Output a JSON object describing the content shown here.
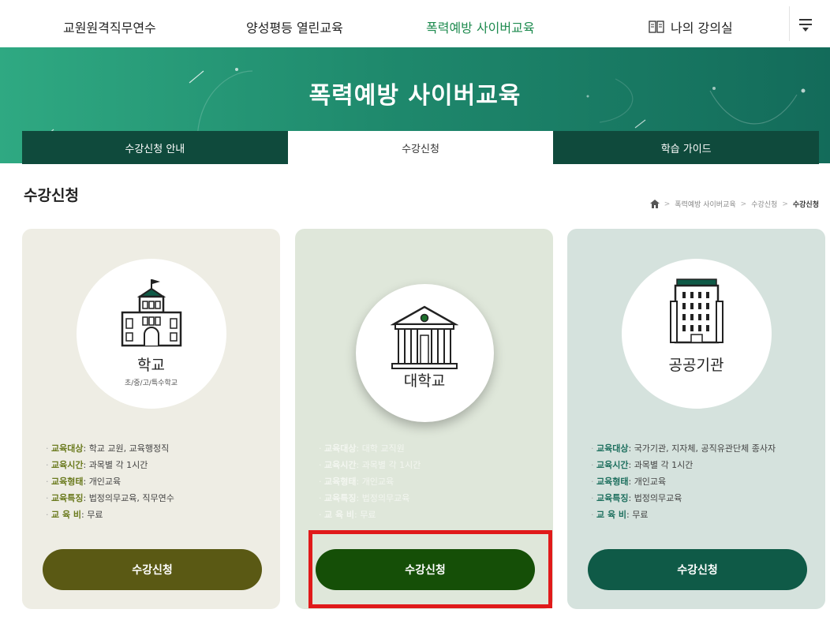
{
  "topnav": {
    "items": [
      "교원원격직무연수",
      "양성평등 열린교육",
      "폭력예방 사이버교육"
    ],
    "my_classroom": "나의 강의실",
    "menu_icon": "menu-icon"
  },
  "banner": {
    "title": "폭력예방 사이버교육"
  },
  "tabs": [
    "수강신청 안내",
    "수강신청",
    "학습 가이드"
  ],
  "page": {
    "title": "수강신청"
  },
  "breadcrumb": {
    "items": [
      "폭력예방 사이버교육",
      "수강신청"
    ],
    "current": "수강신청"
  },
  "cards": [
    {
      "name": "학교",
      "sub": "초/중/고/특수학교",
      "info": [
        {
          "label": "교육대상",
          "value": "학교 교원, 교육행정직"
        },
        {
          "label": "교육시간",
          "value": "과목별 각 1시간"
        },
        {
          "label": "교육형태",
          "value": "개인교육"
        },
        {
          "label": "교육특징",
          "value": "법정의무교육, 직무연수"
        },
        {
          "label": "교 육 비",
          "value": "무료"
        }
      ],
      "button": "수강신청"
    },
    {
      "name": "대학교",
      "info": [
        {
          "label": "교육대상",
          "value": "대학 교직원"
        },
        {
          "label": "교육시간",
          "value": "과목별 각 1시간"
        },
        {
          "label": "교육형태",
          "value": "개인교육"
        },
        {
          "label": "교육특징",
          "value": "법정의무교육"
        },
        {
          "label": "교 육 비",
          "value": "무료"
        }
      ],
      "button": "수강신청"
    },
    {
      "name": "공공기관",
      "info": [
        {
          "label": "교육대상",
          "value": "국가기관, 지자체, 공직유관단체 종사자"
        },
        {
          "label": "교육시간",
          "value": "과목별 각 1시간"
        },
        {
          "label": "교육형태",
          "value": "개인교육"
        },
        {
          "label": "교육특징",
          "value": "법정의무교육"
        },
        {
          "label": "교 육 비",
          "value": "무료"
        }
      ],
      "button": "수강신청"
    }
  ],
  "colors": {
    "active_nav": "#1d8a4e",
    "tab_bg": "#0f4a3c",
    "highlight": "#e01a1a"
  }
}
